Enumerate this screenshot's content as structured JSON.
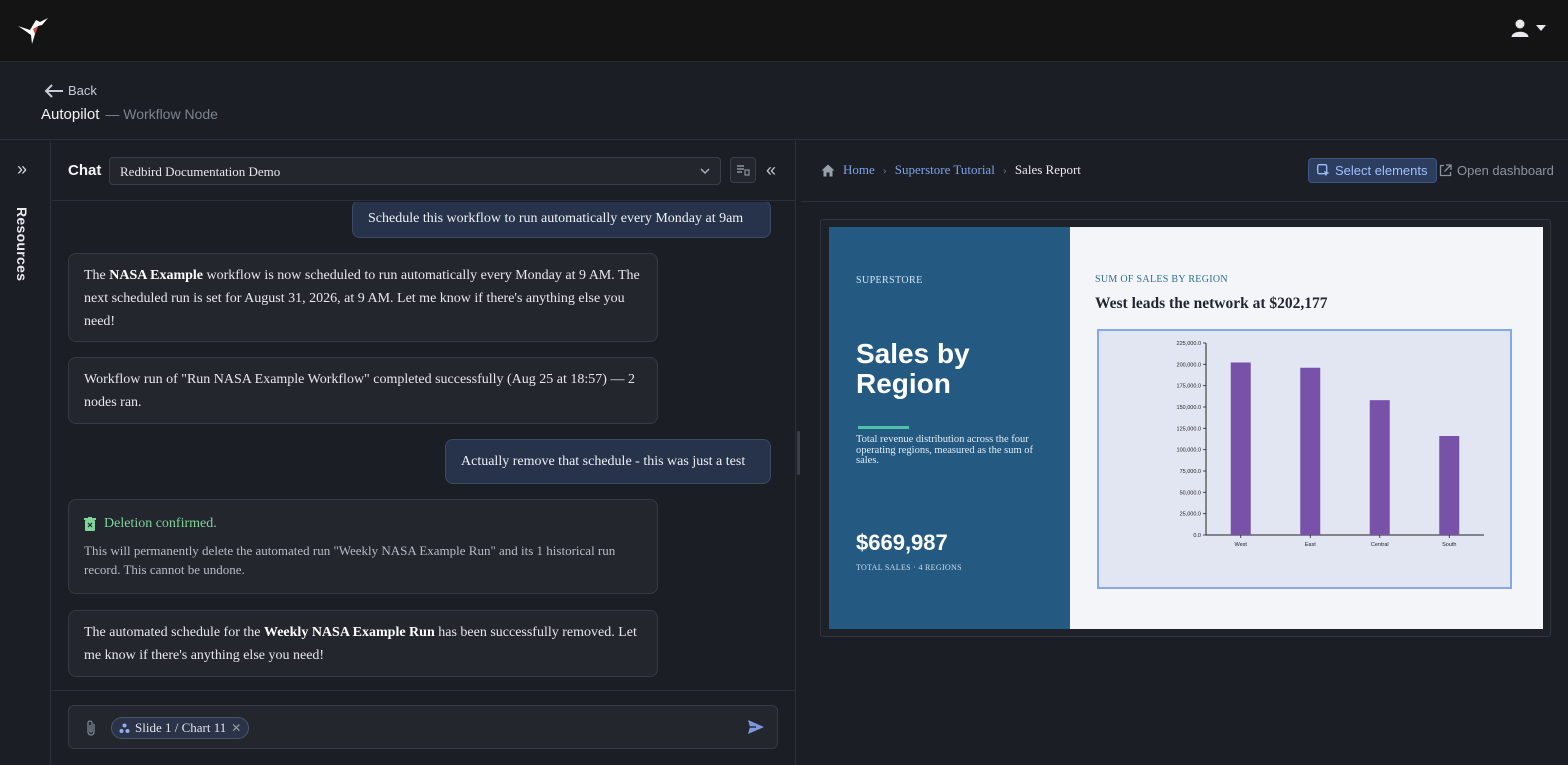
{
  "topbar": {
    "logo_icon": "hummingbird-logo-icon",
    "user_icon": "user-icon"
  },
  "subheader": {
    "back_label": "Back",
    "title": "Autopilot",
    "subtitle": "— Workflow Node"
  },
  "rail": {
    "label": "Resources"
  },
  "chat": {
    "label": "Chat",
    "selected_project": "Redbird Documentation Demo",
    "messages": [
      {
        "role": "user",
        "text": "Schedule this workflow to run automatically every Monday at 9am"
      },
      {
        "role": "assistant",
        "parts": [
          "The ",
          "NASA Example",
          " workflow is now scheduled to run automatically every Monday at 9 AM. The next scheduled run is set for August 31, 2026, at 9 AM. Let me know if there's anything else you need!"
        ]
      },
      {
        "role": "assistant",
        "text": "Workflow run of \"Run NASA Example Workflow\" completed successfully (Aug 25 at 18:57) — 2 nodes ran."
      },
      {
        "role": "user",
        "text": "Actually remove that schedule - this was just a test"
      },
      {
        "role": "assistant",
        "title": "Deletion confirmed.",
        "body": "This will permanently delete the automated run \"Weekly NASA Example Run\" and its 1 historical run record. This cannot be undone."
      },
      {
        "role": "assistant",
        "parts": [
          "The automated schedule for the ",
          "Weekly NASA Example Run",
          " has been successfully removed. Let me know if there's anything else you need!"
        ]
      }
    ],
    "composer": {
      "chip_label": "Slide 1 / Chart 11"
    }
  },
  "preview": {
    "breadcrumb": [
      "Home",
      "Superstore Tutorial",
      "Sales Report"
    ],
    "select_label": "Select elements",
    "open_label": "Open dashboard",
    "slide": {
      "brand": "SUPERSTORE",
      "title": "Sales by Region",
      "description": "Total revenue distribution across the four operating regions, measured as the sum of sales.",
      "total": "$669,987",
      "total_caption": "TOTAL SALES  ·  4 REGIONS",
      "kicker": "SUM OF SALES BY REGION",
      "headline": "West leads the network at $202,177"
    }
  },
  "chart_data": {
    "type": "bar",
    "categories": [
      "West",
      "East",
      "Central",
      "South"
    ],
    "values": [
      202177,
      196000,
      158000,
      116000
    ],
    "yticks": [
      "0.0",
      "25,000.0",
      "50,000.0",
      "75,000.0",
      "100,000.0",
      "125,000.0",
      "150,000.0",
      "175,000.0",
      "200,000.0",
      "225,000.0"
    ],
    "ylim": [
      0,
      225000
    ],
    "color": "#7752a8",
    "title": "",
    "xlabel": "",
    "ylabel": ""
  },
  "colors": {
    "accent": "#7aa3e8",
    "success": "#7fd49a",
    "slide_blue": "#245a82",
    "rule": "#4fc1a6"
  }
}
